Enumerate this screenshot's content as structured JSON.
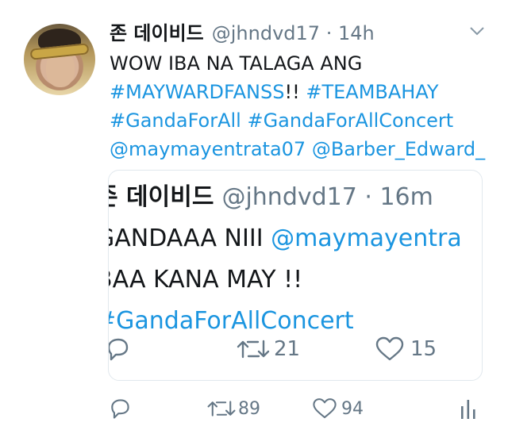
{
  "tweet": {
    "author_name": "존 데이비드",
    "meta": "@jhndvd17 · 14h",
    "lines": [
      [
        {
          "t": "WOW IBA NA TALAGA ANG",
          "link": false
        }
      ],
      [
        {
          "t": "#MAYWARDFANSS",
          "link": true
        },
        {
          "t": "!! ",
          "link": false
        },
        {
          "t": "#TEAMBAHAY",
          "link": true
        }
      ],
      [
        {
          "t": "#GandaForAll",
          "link": true
        },
        {
          "t": " ",
          "link": false
        },
        {
          "t": "#GandaForAllConcert",
          "link": true
        }
      ],
      [
        {
          "t": "@maymayentrata07",
          "link": true
        },
        {
          "t": " ",
          "link": false
        },
        {
          "t": "@Barber_Edward_",
          "link": true
        }
      ]
    ],
    "retweets": "89",
    "likes": "94"
  },
  "quoted": {
    "author_name": "존 데이비드",
    "meta": "@jhndvd17 · 16m",
    "line1_text": "GANDAAA NIII ",
    "line1_link": "@maymayentra",
    "line2": "BAA KANA MAY !!",
    "line3_link": "#GandaForAllConcert",
    "retweets": "21",
    "likes": "15"
  },
  "icons": [
    "chevron-down-icon",
    "reply-icon",
    "retweet-icon",
    "heart-icon",
    "analytics-icon"
  ],
  "colors": {
    "link": "#1b95e0",
    "meta": "#657786",
    "text": "#14171a",
    "border": "#e1e8ed"
  }
}
